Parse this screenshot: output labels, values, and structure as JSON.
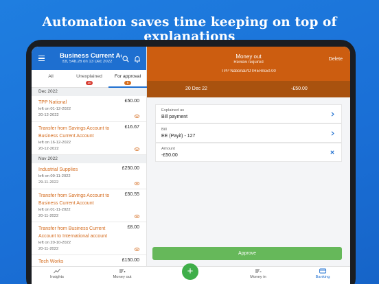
{
  "headline": "Automation saves time keeping on top of explanations",
  "account": {
    "title": "Business Current Ac...",
    "balance_line": "£8, 548.26 on 13 Dec 2022"
  },
  "tabs": [
    {
      "label": "All"
    },
    {
      "label": "Unexplained",
      "badge": "10"
    },
    {
      "label": "For approval",
      "badge": "6"
    }
  ],
  "sections": [
    {
      "label": "Dec 2022",
      "items": [
        {
          "name_lines": [
            "TPP National"
          ],
          "amount": "£50.00",
          "left_on": "left on 01-12-2022",
          "date": "20-12-2022"
        },
        {
          "name_lines": [
            "Transfer from Savings Account to",
            "Business Current Account"
          ],
          "amount": "£16.67",
          "left_on": "left on 16-12-2022",
          "date": "20-12-2022"
        }
      ]
    },
    {
      "label": "Nov 2022",
      "items": [
        {
          "name_lines": [
            "Industrial Supplies"
          ],
          "amount": "£250.00",
          "left_on": "left on 09-11-2022",
          "date": "29-11-2022"
        },
        {
          "name_lines": [
            "Transfer from Savings Account to",
            "Business Current Account"
          ],
          "amount": "£50.55",
          "left_on": "left on 01-11-2022",
          "date": "20-11-2022"
        },
        {
          "name_lines": [
            "Transfer from Business Current",
            "Account to International account"
          ],
          "amount": "£8.00",
          "left_on": "left on 20-10-2022",
          "date": "20-11-2022"
        },
        {
          "name_lines": [
            "Tech Works"
          ],
          "amount": "£150.00",
          "left_on": "",
          "date": ""
        }
      ]
    }
  ],
  "detail": {
    "title": "Money out",
    "subtitle": "Review required",
    "contact": "TPP National//OTHER/£50.00",
    "delete_label": "Delete",
    "date": "20 Dec 22",
    "amount": "-£50.00",
    "fields": [
      {
        "label": "Explained as",
        "value": "Bill payment",
        "action": "chevron-right-icon"
      },
      {
        "label": "Bill",
        "value": "EE (Payit) - 127",
        "action": "chevron-right-icon"
      },
      {
        "label": "Amount",
        "value": "-£50.00",
        "action": "close-icon"
      }
    ],
    "approve_label": "Approve"
  },
  "bottom_nav": [
    {
      "label": "Insights",
      "icon": "chart-line-icon"
    },
    {
      "label": "Money out",
      "icon": "money-out-icon"
    },
    {
      "label": "Money in",
      "icon": "money-in-icon"
    },
    {
      "label": "Banking",
      "icon": "bank-card-icon",
      "active": true
    }
  ],
  "colors": {
    "background": "#1a6fd6",
    "header_blue": "#1e6fd0",
    "accent_orange": "#cc5d10",
    "orange_dark": "#a9520f",
    "approve_green": "#66b85a",
    "fab_green": "#3fae49"
  }
}
